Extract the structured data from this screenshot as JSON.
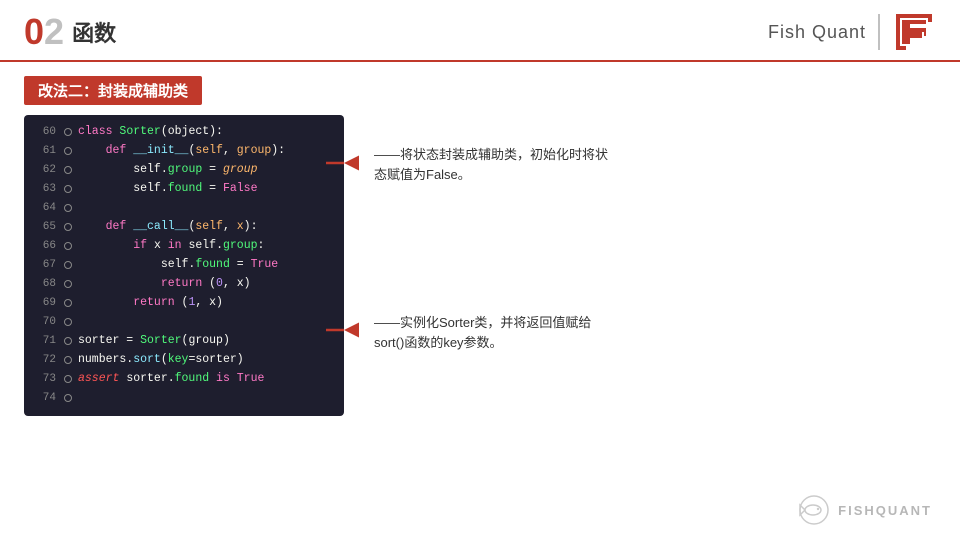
{
  "header": {
    "num": "02",
    "title": "函数",
    "brand": "Fish Quant"
  },
  "section": {
    "label": "改法二：封装成辅助类"
  },
  "code": {
    "lines": [
      {
        "num": "60",
        "indent": 0,
        "content": "class Sorter(object):"
      },
      {
        "num": "61",
        "indent": 1,
        "content": "    def __init__(self, group):"
      },
      {
        "num": "62",
        "indent": 2,
        "content": "        self.group = group"
      },
      {
        "num": "63",
        "indent": 2,
        "content": "        self.found = False"
      },
      {
        "num": "64",
        "indent": 0,
        "content": ""
      },
      {
        "num": "65",
        "indent": 1,
        "content": "    def __call__(self, x):"
      },
      {
        "num": "66",
        "indent": 2,
        "content": "        if x in self.group:"
      },
      {
        "num": "67",
        "indent": 3,
        "content": "            self.found = True"
      },
      {
        "num": "68",
        "indent": 3,
        "content": "            return (0, x)"
      },
      {
        "num": "69",
        "indent": 2,
        "content": "        return (1, x)"
      },
      {
        "num": "70",
        "indent": 0,
        "content": ""
      },
      {
        "num": "71",
        "indent": 0,
        "content": "sorter = Sorter(group)"
      },
      {
        "num": "72",
        "indent": 0,
        "content": "numbers.sort(key=sorter)"
      },
      {
        "num": "73",
        "indent": 0,
        "content": "assert sorter.found is True"
      },
      {
        "num": "74",
        "indent": 0,
        "content": ""
      }
    ]
  },
  "annotations": [
    {
      "id": "ann1",
      "text": "——将状态封装成辅助类，初始化时将状态赋值为False。",
      "target_line": "63"
    },
    {
      "id": "ann2",
      "text": "——实例化Sorter类，并将返回值赋给sort()函数的key参数。",
      "target_line": "71"
    }
  ],
  "footer": {
    "text": "FISHQUANT"
  }
}
